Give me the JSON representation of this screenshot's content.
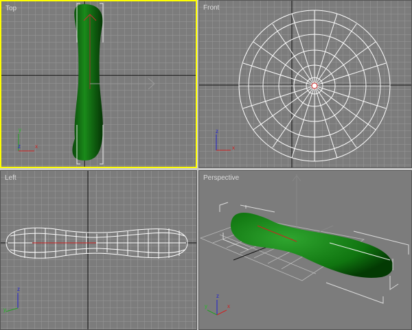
{
  "viewports": {
    "top": {
      "label": "Top",
      "active": true
    },
    "front": {
      "label": "Front"
    },
    "left": {
      "label": "Left"
    },
    "perspective": {
      "label": "Perspective"
    }
  },
  "axis_labels": {
    "x": "x",
    "y": "y",
    "z": "z"
  },
  "colors": {
    "active_border": "#ffff00",
    "viewport_bg": "#7c7c7c",
    "grid": "#999999",
    "object": "#1a8a1a",
    "x_axis": "#d02020",
    "y_axis": "#20a020",
    "z_axis": "#2020d0"
  }
}
